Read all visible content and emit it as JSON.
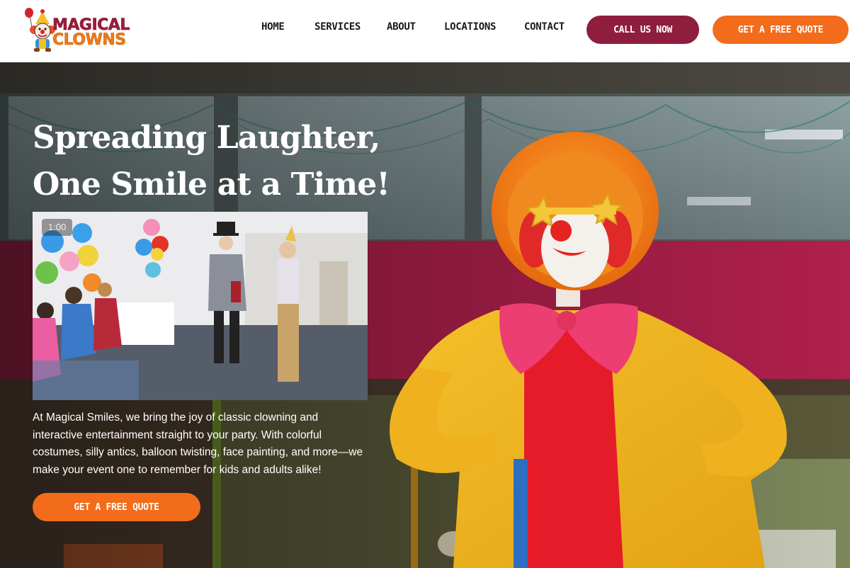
{
  "brand": {
    "logo_line1": "MAGICAL",
    "logo_line2": "CLOWNS",
    "primary_color": "#8e1d3e",
    "accent_color": "#f26c1b"
  },
  "nav": {
    "items": [
      {
        "label": "HOME"
      },
      {
        "label": "SERVICES"
      },
      {
        "label": "ABOUT"
      },
      {
        "label": "LOCATIONS"
      },
      {
        "label": "CONTACT"
      }
    ],
    "call_label": "CALL US NOW",
    "quote_label": "GET A FREE QUOTE"
  },
  "hero": {
    "title_line1": "Spreading Laughter,",
    "title_line2": "One Smile at a Time!",
    "video_time": "1:00",
    "description": "At Magical Smiles, we bring the joy of classic clowning and interactive entertainment straight to your party. With colorful costumes, silly antics, balloon twisting, face painting, and more—we make your event one to remember for kids and adults alike!",
    "cta_label": "GET A FREE QUOTE"
  }
}
